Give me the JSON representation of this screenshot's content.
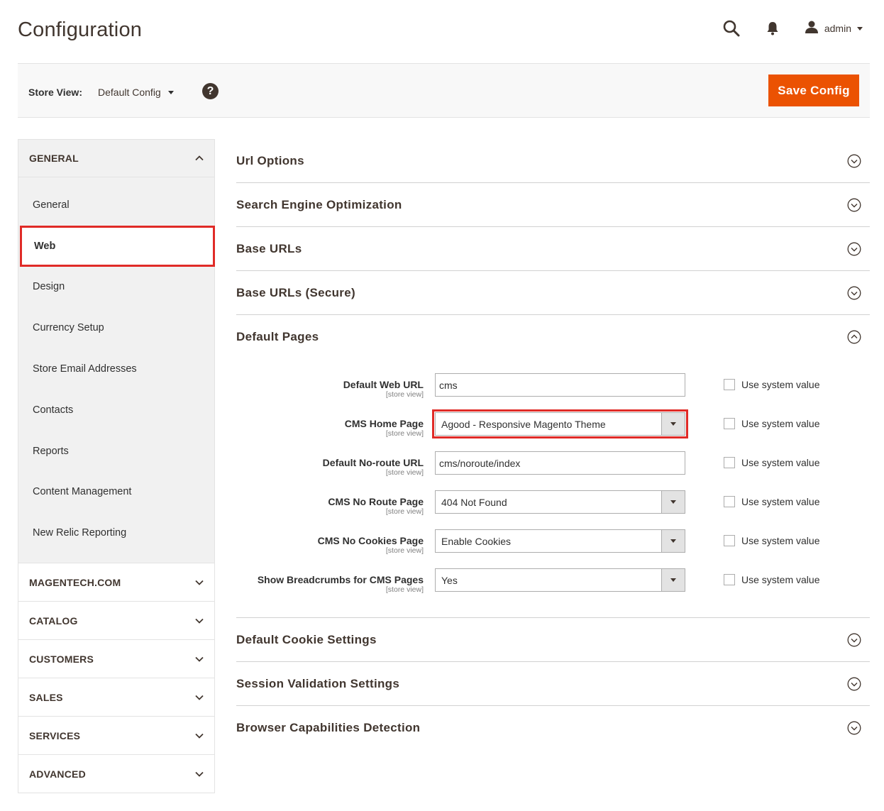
{
  "header": {
    "title": "Configuration",
    "user_name": "admin"
  },
  "store_bar": {
    "label": "Store View:",
    "selected": "Default Config",
    "save_label": "Save Config"
  },
  "sidebar": {
    "general": {
      "title": "GENERAL",
      "items": [
        {
          "label": "General"
        },
        {
          "label": "Web"
        },
        {
          "label": "Design"
        },
        {
          "label": "Currency Setup"
        },
        {
          "label": "Store Email Addresses"
        },
        {
          "label": "Contacts"
        },
        {
          "label": "Reports"
        },
        {
          "label": "Content Management"
        },
        {
          "label": "New Relic Reporting"
        }
      ]
    },
    "sections": [
      {
        "title": "MAGENTECH.COM"
      },
      {
        "title": "CATALOG"
      },
      {
        "title": "CUSTOMERS"
      },
      {
        "title": "SALES"
      },
      {
        "title": "SERVICES"
      },
      {
        "title": "ADVANCED"
      }
    ]
  },
  "main": {
    "groups_before": [
      {
        "title": "Url Options"
      },
      {
        "title": "Search Engine Optimization"
      },
      {
        "title": "Base URLs"
      },
      {
        "title": "Base URLs (Secure)"
      }
    ],
    "open_group": {
      "title": "Default Pages",
      "fields": [
        {
          "label": "Default Web URL",
          "scope": "[store view]",
          "value": "cms",
          "sys": "Use system value"
        },
        {
          "label": "CMS Home Page",
          "scope": "[store view]",
          "value": "Agood - Responsive Magento Theme",
          "sys": "Use system value"
        },
        {
          "label": "Default No-route URL",
          "scope": "[store view]",
          "value": "cms/noroute/index",
          "sys": "Use system value"
        },
        {
          "label": "CMS No Route Page",
          "scope": "[store view]",
          "value": "404 Not Found",
          "sys": "Use system value"
        },
        {
          "label": "CMS No Cookies Page",
          "scope": "[store view]",
          "value": "Enable Cookies",
          "sys": "Use system value"
        },
        {
          "label": "Show Breadcrumbs for CMS Pages",
          "scope": "[store view]",
          "value": "Yes",
          "sys": "Use system value"
        }
      ]
    },
    "groups_after": [
      {
        "title": "Default Cookie Settings"
      },
      {
        "title": "Session Validation Settings"
      },
      {
        "title": "Browser Capabilities Detection"
      }
    ]
  },
  "colors": {
    "accent": "#eb5202",
    "highlight": "#e02b27"
  }
}
